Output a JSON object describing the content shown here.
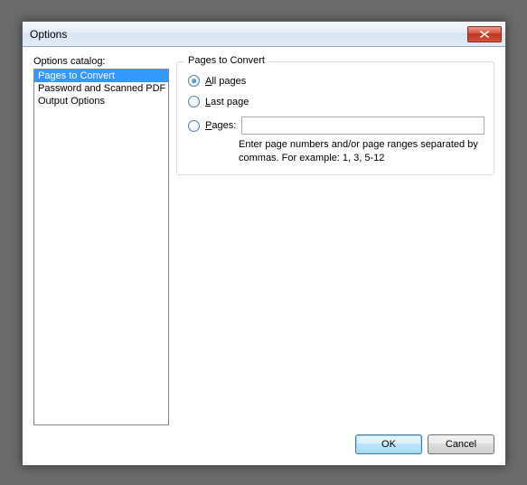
{
  "window": {
    "title": "Options"
  },
  "catalog": {
    "label": "Options catalog:",
    "items": [
      {
        "label": "Pages to Convert",
        "selected": true
      },
      {
        "label": "Password and Scanned PDF",
        "selected": false
      },
      {
        "label": "Output Options",
        "selected": false
      }
    ]
  },
  "panel": {
    "title": "Pages to Convert",
    "radios": {
      "all": {
        "label_pre": "",
        "label_u": "A",
        "label_post": "ll pages",
        "checked": true
      },
      "last": {
        "label_pre": "",
        "label_u": "L",
        "label_post": "ast page",
        "checked": false
      },
      "pages": {
        "label_pre": "",
        "label_u": "P",
        "label_post": "ages:",
        "checked": false
      }
    },
    "pages_input": {
      "value": ""
    },
    "hint": "Enter page numbers and/or page ranges separated by commas. For example: 1, 3, 5-12"
  },
  "buttons": {
    "ok": "OK",
    "cancel": "Cancel"
  }
}
